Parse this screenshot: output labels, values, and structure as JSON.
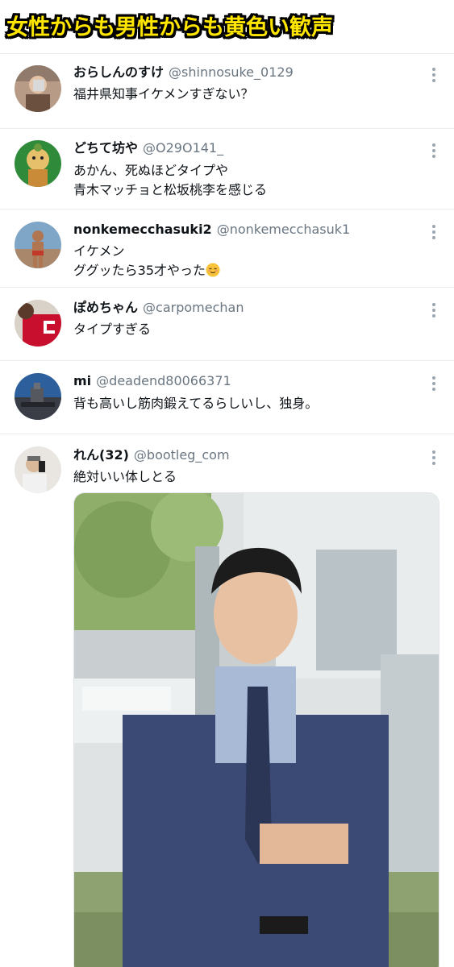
{
  "banner": {
    "title": "女性からも男性からも黄色い歓声"
  },
  "tweets": [
    {
      "name": "おらしんのすけ",
      "handle": "@shinnosuke_0129",
      "lines": [
        "福井県知事イケメンすぎない？"
      ]
    },
    {
      "name": "どちて坊や",
      "handle": "@O29O141_",
      "lines": [
        "あかん、死ぬほどタイプや",
        "青木マッチョと松坂桃李を感じる"
      ]
    },
    {
      "name": "nonkemecchasuki2",
      "handle": "@nonkemecchasuk1",
      "lines": [
        "イケメン",
        "ググッたら35才やった"
      ]
    },
    {
      "name": "ぽめちゃん",
      "handle": "@carpomechan",
      "lines": [
        "タイプすぎる"
      ]
    },
    {
      "name": "mi",
      "handle": "@deadend80066371",
      "lines": [
        "背も高いし筋肉鍛えてるらしいし、独身。"
      ]
    },
    {
      "name": "れん(32)",
      "handle": "@bootleg_com",
      "lines": [
        "絶対いい体しとる"
      ]
    }
  ],
  "icons": {
    "more": "more-vertical-icon",
    "emoji": "relieved-face-emoji-icon"
  },
  "colors": {
    "banner_text": "#ffe600",
    "banner_outline": "#000000",
    "handle": "#6a7681",
    "divider": "#e6ecf0"
  }
}
